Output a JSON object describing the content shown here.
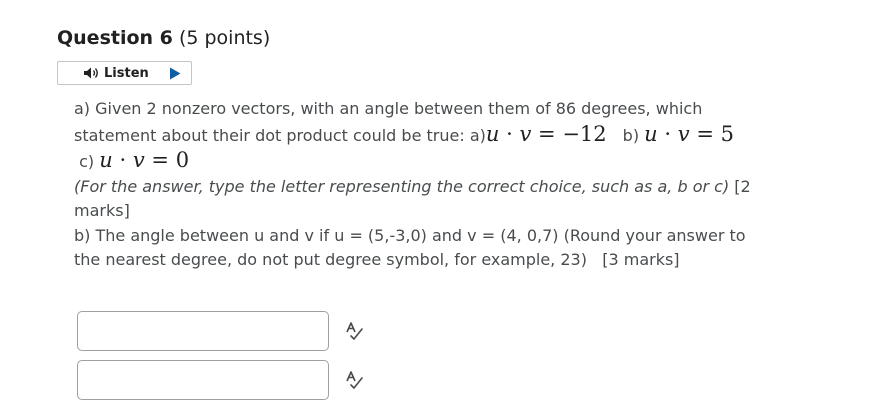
{
  "question": {
    "name": "Question 6",
    "points": "(5 points)"
  },
  "listen": {
    "label": "Listen"
  },
  "body": {
    "line1": "a) Given 2 nonzero vectors, with an angle between them of 86 degrees, which",
    "line2_prefix": "statement about their dot product could be true: a)",
    "math_a": {
      "u": "u",
      "dot": "·",
      "v": "v",
      "eq": "=",
      "val": "−12"
    },
    "option_b_label": "b)",
    "math_b": {
      "u": "u",
      "dot": "·",
      "v": "v",
      "eq": "=",
      "val": "5"
    },
    "option_c_label": "c)",
    "math_c": {
      "u": "u",
      "dot": "·",
      "v": "v",
      "eq": "=",
      "val": "0"
    },
    "instruction_line1": "(For the answer, type the letter representing the correct choice, such as a, b or c)",
    "instruction_marks": "[2",
    "instruction_line2": "marks]",
    "part_b_line1": "b) The angle between u and v if u = (5,-3,0) and v = (4, 0,7) (Round your answer to",
    "part_b_line2": "the nearest degree, do not put degree symbol, for example, 23)",
    "part_b_marks": "[3 marks]"
  },
  "answers": [
    {
      "value": "",
      "placeholder": ""
    },
    {
      "value": "",
      "placeholder": ""
    }
  ],
  "icons": {
    "speaker": "speaker-icon",
    "play": "play-icon",
    "spell_check": "spell-check-icon"
  },
  "colors": {
    "title": "#202122",
    "body_text": "#494c4e",
    "input_border": "#9ea0a3",
    "listen_border": "#c3c6c9"
  }
}
